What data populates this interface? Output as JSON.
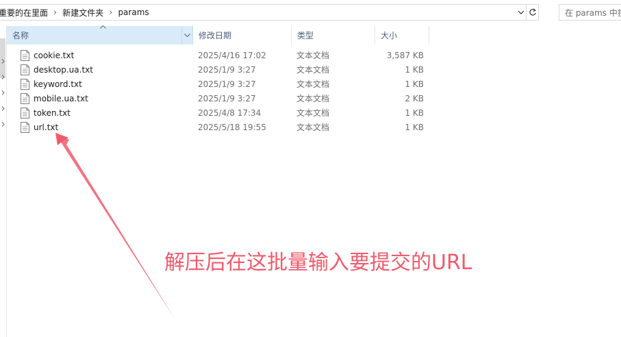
{
  "address_bar": {
    "breadcrumbs": [
      "重要的在里面",
      "新建文件夹",
      "params"
    ],
    "separator": "›",
    "dropdown_icon": "chevron-down-icon",
    "refresh_icon": "refresh-icon"
  },
  "search": {
    "placeholder": "在 params 中搜索"
  },
  "columns": {
    "name": "名称",
    "date": "修改日期",
    "type": "类型",
    "size": "大小"
  },
  "files": [
    {
      "name": "cookie.txt",
      "date": "2025/4/16 17:02",
      "type": "文本文档",
      "size": "3,587 KB"
    },
    {
      "name": "desktop.ua.txt",
      "date": "2025/1/9 3:27",
      "type": "文本文档",
      "size": "1 KB"
    },
    {
      "name": "keyword.txt",
      "date": "2025/1/9 3:27",
      "type": "文本文档",
      "size": "1 KB"
    },
    {
      "name": "mobile.ua.txt",
      "date": "2025/1/9 3:27",
      "type": "文本文档",
      "size": "2 KB"
    },
    {
      "name": "token.txt",
      "date": "2025/4/8 17:34",
      "type": "文本文档",
      "size": "1 KB"
    },
    {
      "name": "url.txt",
      "date": "2025/5/18 19:55",
      "type": "文本文档",
      "size": "1 KB"
    }
  ],
  "annotation": {
    "text": "解压后在这批量输入要提交的URL",
    "color": "#f25a6b"
  },
  "colors": {
    "sorted_header_bg": "#d9ebf9",
    "header_text": "#4c607a"
  }
}
